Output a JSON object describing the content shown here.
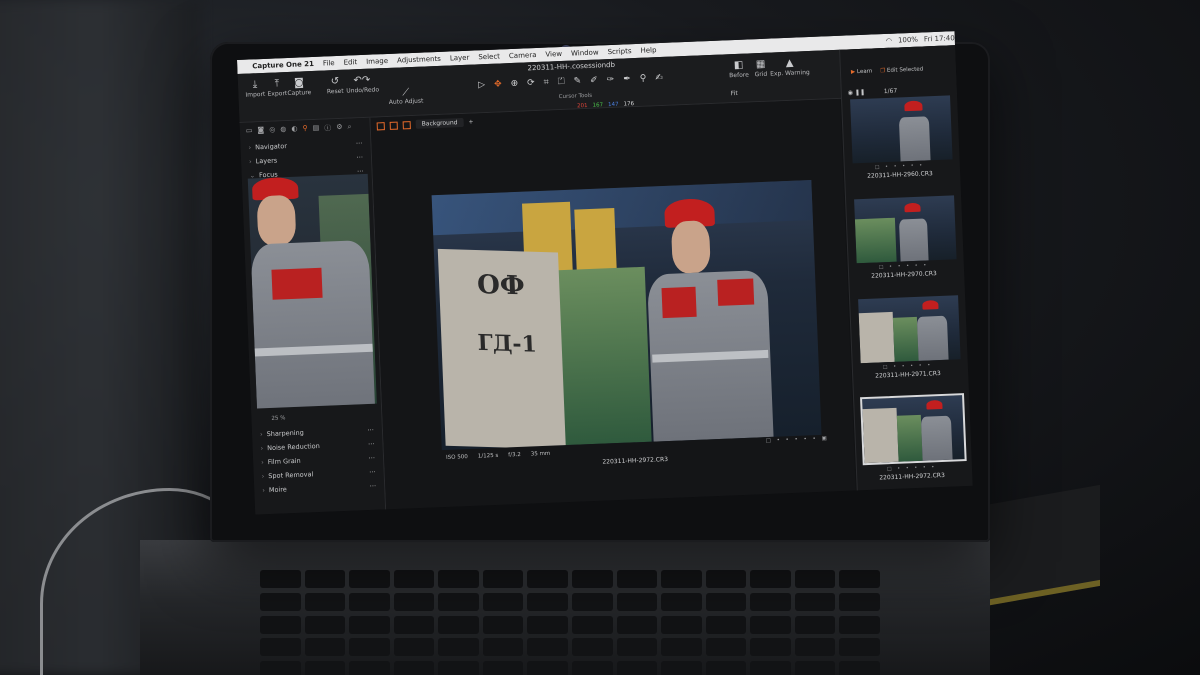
{
  "menubar": {
    "app_name": "Capture One 21",
    "items": [
      "File",
      "Edit",
      "Image",
      "Adjustments",
      "Layer",
      "Select",
      "Camera",
      "View",
      "Window",
      "Scripts",
      "Help"
    ],
    "battery": "100%",
    "clock": "Fri 17:40"
  },
  "toolbar": {
    "document_title": "220311-HH-.cosessiondb",
    "buttons_left": [
      {
        "label": "Import",
        "icon": "import-icon"
      },
      {
        "label": "Export",
        "icon": "export-icon"
      },
      {
        "label": "Capture",
        "icon": "camera-icon"
      }
    ],
    "reset_label": "Reset",
    "undo_redo_label": "Undo/Redo",
    "auto_adjust_label": "Auto Adjust",
    "cursor_tools_label": "Cursor Tools",
    "rgb": {
      "r": "201",
      "g": "167",
      "b": "147",
      "a": "176"
    },
    "buttons_right": [
      {
        "label": "Before",
        "icon": "before-icon"
      },
      {
        "label": "Grid",
        "icon": "grid-icon"
      },
      {
        "label": "Exp. Warning",
        "icon": "warning-icon"
      }
    ],
    "fit_label": "Fit",
    "learn_label": "Learn",
    "edit_selected_label": "Edit Selected",
    "accent_color": "#e46a2a"
  },
  "left_panel": {
    "sections_top": [
      "Navigator",
      "Layers",
      "Focus"
    ],
    "zoom_label": "25 %",
    "sections_bottom": [
      "Sharpening",
      "Noise Reduction",
      "Film Grain",
      "Spot Removal",
      "Moire"
    ]
  },
  "viewer": {
    "background_option": "Background",
    "photo_info": {
      "iso": "ISO 500",
      "shutter": "1/125 s",
      "aperture": "f/3.2",
      "focal": "35 mm"
    },
    "photo_name": "220311-HH-2972.CR3",
    "panel_text_top": "ОФ",
    "panel_text_bottom": "ГД-1"
  },
  "browser": {
    "count": "1/67",
    "thumbnails": [
      {
        "name": "220311-HH-2960.CR3",
        "selected": false
      },
      {
        "name": "220311-HH-2970.CR3",
        "selected": false
      },
      {
        "name": "220311-HH-2971.CR3",
        "selected": false
      },
      {
        "name": "220311-HH-2972.CR3",
        "selected": true
      }
    ]
  }
}
